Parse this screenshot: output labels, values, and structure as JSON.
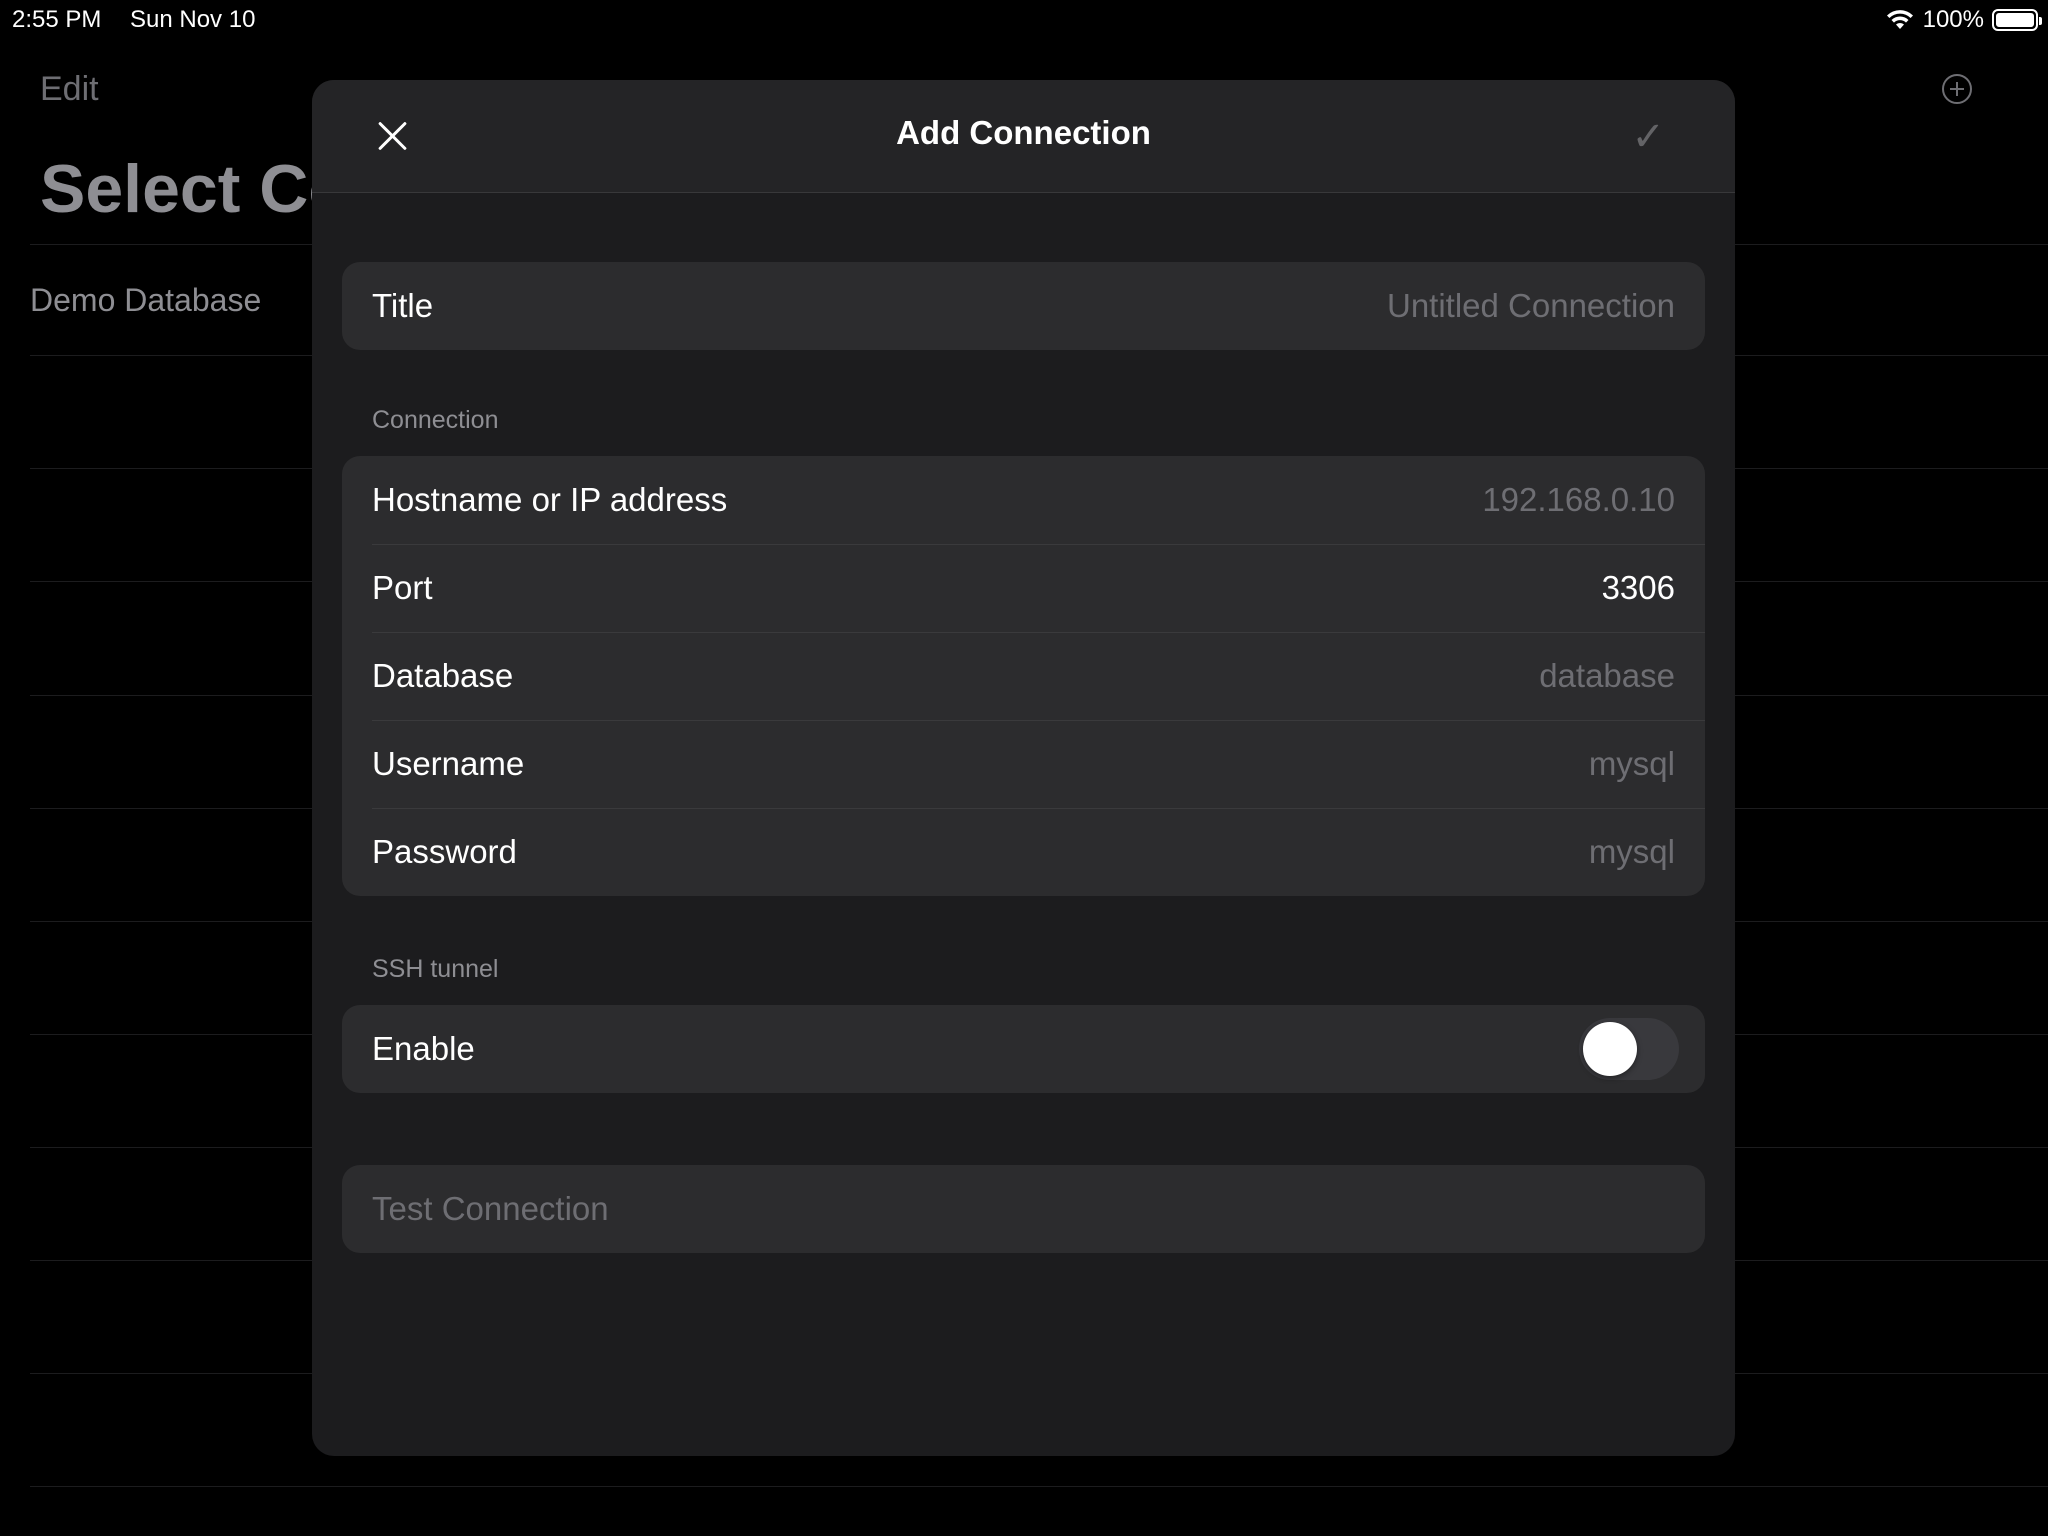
{
  "status_bar": {
    "time": "2:55 PM",
    "date": "Sun Nov 10",
    "battery": "100%",
    "wifi_icon": "wifi-icon",
    "battery_icon": "battery-icon"
  },
  "background": {
    "edit_label": "Edit",
    "title": "Select Co",
    "row_label": "Demo Database",
    "add_icon": "plus-circle-icon"
  },
  "modal": {
    "title": "Add Connection",
    "close_icon": "close-icon",
    "done_icon": "checkmark-icon",
    "done_glyph": "✓",
    "title_row": {
      "label": "Title",
      "placeholder": "Untitled Connection"
    },
    "connection_section": {
      "header": "Connection",
      "rows": [
        {
          "label": "Hostname or IP address",
          "value": "192.168.0.10",
          "is_placeholder": true
        },
        {
          "label": "Port",
          "value": "3306",
          "is_placeholder": false
        },
        {
          "label": "Database",
          "value": "database",
          "is_placeholder": true
        },
        {
          "label": "Username",
          "value": "mysql",
          "is_placeholder": true
        },
        {
          "label": "Password",
          "value": "mysql",
          "is_placeholder": true
        }
      ]
    },
    "ssh_section": {
      "header": "SSH tunnel",
      "enable_label": "Enable",
      "enabled": false
    },
    "test_button_label": "Test Connection"
  },
  "colors": {
    "background": "#000000",
    "modal": "#1c1c1e",
    "cell": "#2c2c2e",
    "placeholder": "#6e6e73",
    "separator": "#3a3a3c"
  }
}
